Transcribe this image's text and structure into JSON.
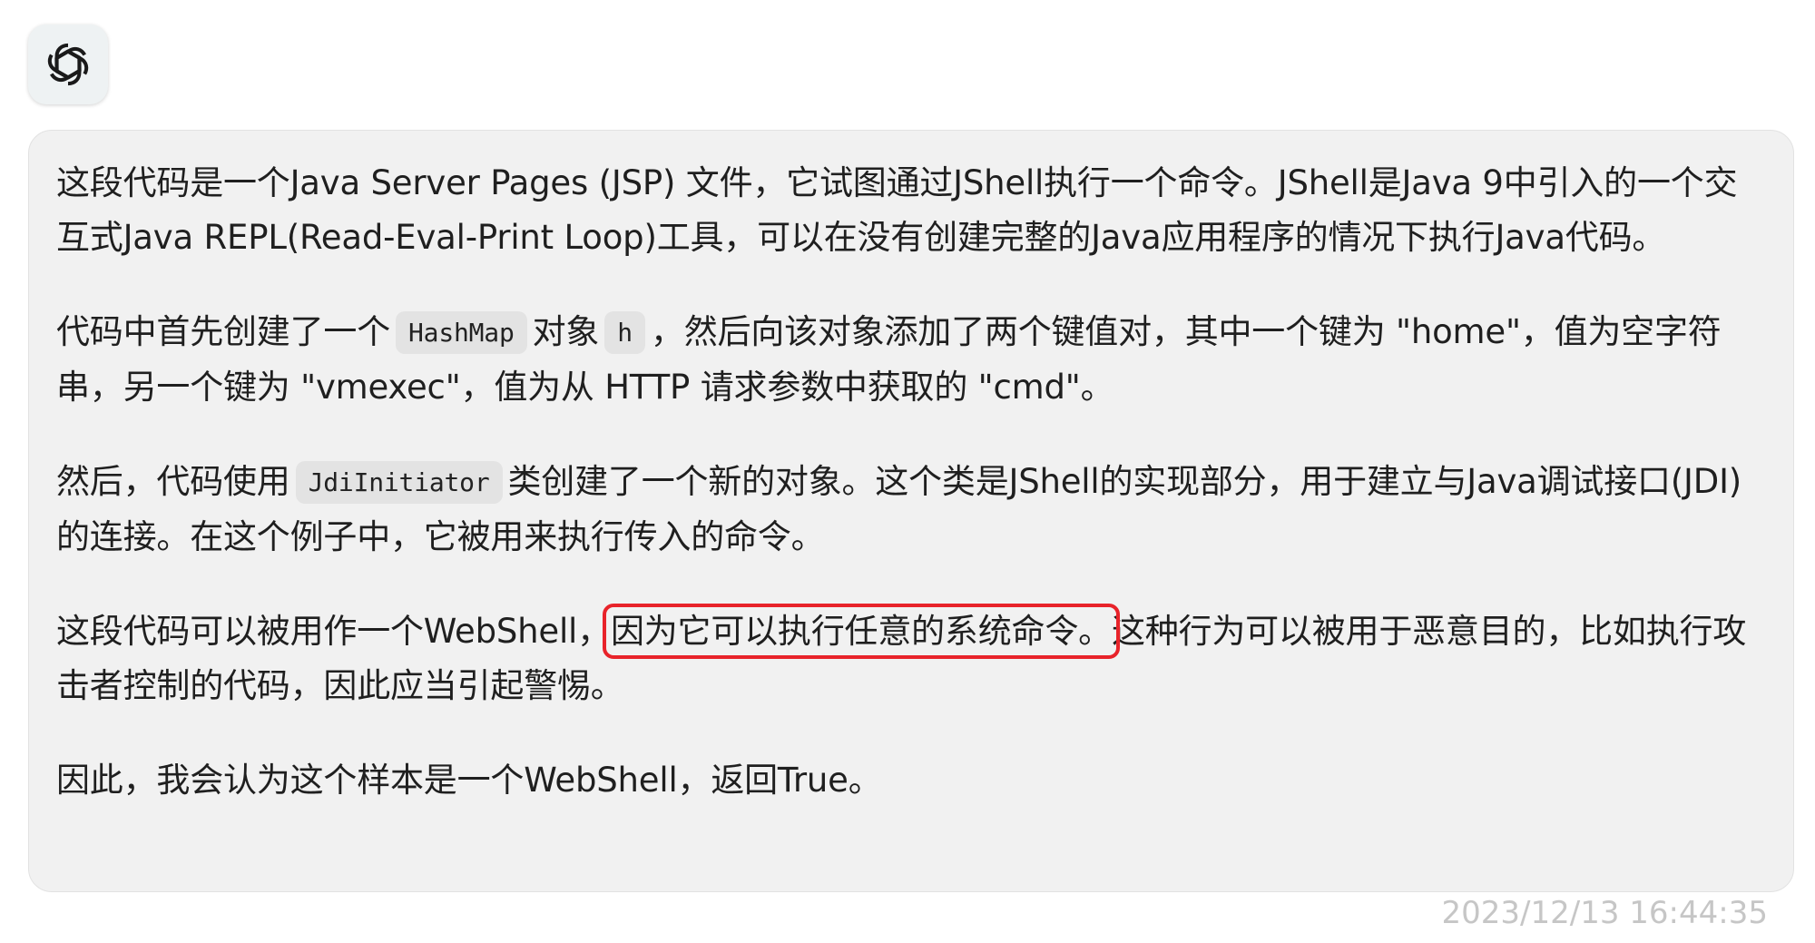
{
  "avatar": {
    "icon": "openai-logo-icon"
  },
  "message": {
    "p1": "这段代码是一个Java Server Pages (JSP) 文件，它试图通过JShell执行一个命令。JShell是Java 9中引入的一个交互式Java REPL(Read-Eval-Print Loop)工具，可以在没有创建完整的Java应用程序的情况下执行Java代码。",
    "p2": {
      "t1": "代码中首先创建了一个",
      "c1": "HashMap",
      "t2": "对象",
      "c2": "h",
      "t3": "，然后向该对象添加了两个键值对，其中一个键为 \"home\"，值为空字符串，另一个键为 \"vmexec\"，值为从 HTTP 请求参数中获取的 \"cmd\"。"
    },
    "p3": {
      "t1": "然后，代码使用",
      "c1": "JdiInitiator",
      "t2": "类创建了一个新的对象。这个类是JShell的实现部分，用于建立与Java调试接口(JDI)的连接。在这个例子中，它被用来执行传入的命令。"
    },
    "p4": {
      "t1": "这段代码可以被用作一个WebShell，",
      "highlight": "因为它可以执行任意的系统命令。",
      "t2": "这种行为可以被用于恶意目的，比如执行攻击者控制的代码，因此应当引起警惕。"
    },
    "p5": "因此，我会认为这个样本是一个WebShell，返回True。"
  },
  "timestamp": "2023/12/13 16:44:35",
  "colors": {
    "bubble_bg": "#f1f1f1",
    "highlight_box": "#e8232a",
    "timestamp": "#c6c6c6"
  }
}
